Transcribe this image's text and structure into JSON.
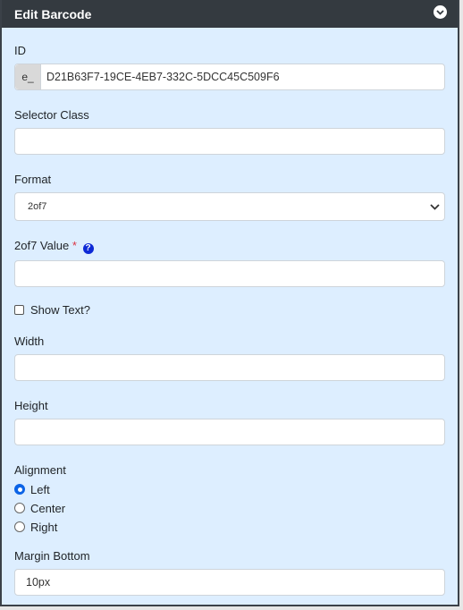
{
  "header": {
    "title": "Edit Barcode"
  },
  "fields": {
    "id": {
      "label": "ID",
      "prefix": "e_",
      "value": "D21B63F7-19CE-4EB7-332C-5DCC45C509F6"
    },
    "selector_class": {
      "label": "Selector Class",
      "value": ""
    },
    "format": {
      "label": "Format",
      "selected": "2of7"
    },
    "value": {
      "label": "2of7 Value",
      "required_mark": "*",
      "help": "?",
      "value": ""
    },
    "show_text": {
      "label": "Show Text?",
      "checked": false
    },
    "width": {
      "label": "Width",
      "value": ""
    },
    "height": {
      "label": "Height",
      "value": ""
    },
    "alignment": {
      "label": "Alignment",
      "options": [
        "Left",
        "Center",
        "Right"
      ],
      "selected": "Left"
    },
    "margin_bottom": {
      "label": "Margin Bottom",
      "value": "10px"
    }
  },
  "colors": {
    "panel_bg": "#ddeeff",
    "header_bg": "#343a40",
    "accent": "#0b63e6",
    "required": "#dc3545"
  }
}
